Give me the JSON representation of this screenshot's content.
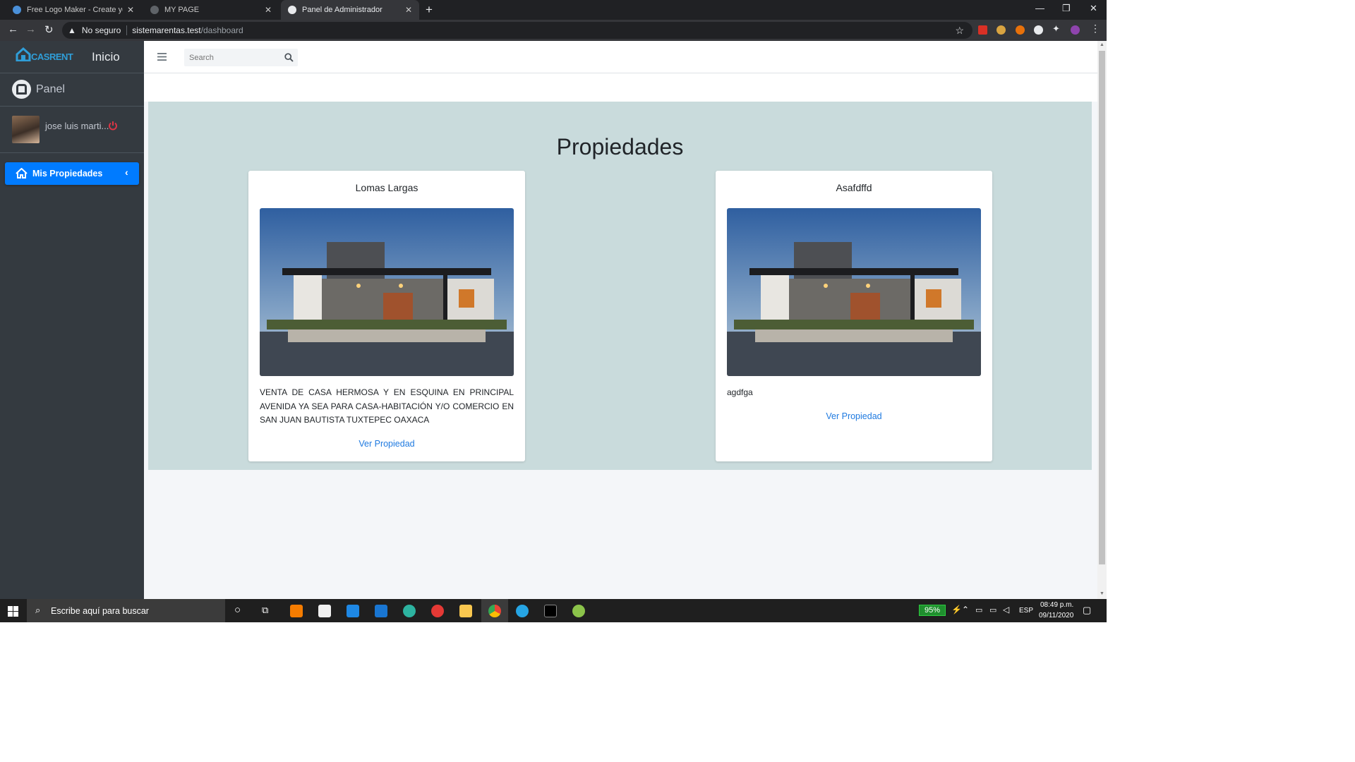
{
  "browser": {
    "tabs": [
      {
        "title": "Free Logo Maker - Create your o",
        "active": false
      },
      {
        "title": "MY PAGE",
        "active": false
      },
      {
        "title": "Panel de Administrador",
        "active": true
      }
    ],
    "security_label": "No seguro",
    "url_host": "sistemarentas.test",
    "url_path": "/dashboard"
  },
  "sidebar": {
    "brand": "CASRENT",
    "inicio": "Inicio",
    "panel": "Panel",
    "user_name": "jose luis marti...",
    "menu_item": "Mis Propiedades"
  },
  "navbar": {
    "search_placeholder": "Search"
  },
  "main": {
    "heading": "Propiedades",
    "cards": [
      {
        "title": "Lomas Largas",
        "description": "VENTA DE CASA HERMOSA Y EN ESQUINA EN PRINCIPAL AVENIDA YA SEA PARA CASA-HABITACIÓN Y/O COMERCIO EN SAN JUAN BAUTISTA TUXTEPEC OAXACA",
        "link": "Ver Propiedad"
      },
      {
        "title": "Asafdffd",
        "description": "agdfga",
        "link": "Ver Propiedad"
      }
    ]
  },
  "taskbar": {
    "search_placeholder": "Escribe aquí para buscar",
    "battery": "95%",
    "language": "ESP",
    "time": "08:49 p.m.",
    "date": "09/11/2020"
  },
  "colors": {
    "sidebar_bg": "#343a40",
    "menu_active": "#007bff",
    "link": "#1f7ae0",
    "content_panel": "#c9dbdc"
  }
}
